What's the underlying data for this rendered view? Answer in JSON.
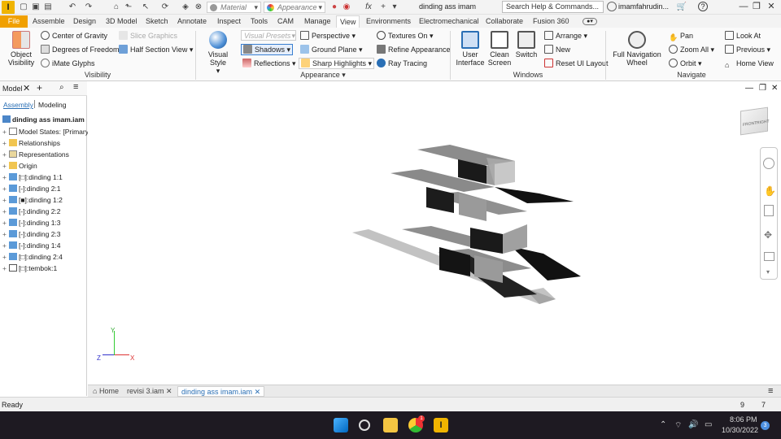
{
  "titlebar": {
    "app_logo": "I",
    "material_placeholder": "Material",
    "appearance_placeholder": "Appearance",
    "doc_title": "dinding ass imam",
    "search_placeholder": "Search Help & Commands...",
    "user": "imamfahrudin...",
    "help": "?",
    "fx": "fx"
  },
  "tabs": [
    "File",
    "Assemble",
    "Design",
    "3D Model",
    "Sketch",
    "Annotate",
    "Inspect",
    "Tools",
    "CAM",
    "Manage",
    "View",
    "Environments",
    "Electromechanical",
    "Collaborate",
    "Fusion 360"
  ],
  "ribbon": {
    "visibility": {
      "title": "Visibility",
      "object_visibility": "Object Visibility",
      "center_of_gravity": "Center of Gravity",
      "degrees_of_freedom": "Degrees of Freedom",
      "imate_glyphs": "iMate Glyphs",
      "slice_graphics": "Slice Graphics",
      "half_section_view": "Half Section View"
    },
    "appearance": {
      "title": "Appearance",
      "visual_style": "Visual Style",
      "visual_presets": "Visual Presets",
      "shadows": "Shadows",
      "reflections": "Reflections",
      "perspective": "Perspective",
      "ground_plane": "Ground Plane",
      "sharp_highlights": "Sharp Highlights",
      "textures_on": "Textures On",
      "refine_appearance": "Refine Appearance",
      "ray_tracing": "Ray Tracing"
    },
    "windows": {
      "title": "Windows",
      "user_interface": "User Interface",
      "clean_screen": "Clean Screen",
      "switch": "Switch",
      "arrange": "Arrange",
      "new": "New",
      "reset_ui_layout": "Reset UI Layout"
    },
    "navigate": {
      "title": "Navigate",
      "full_navigation_wheel": "Full Navigation Wheel",
      "pan": "Pan",
      "zoom_all": "Zoom All",
      "orbit": "Orbit",
      "look_at": "Look At",
      "previous": "Previous",
      "home_view": "Home View"
    }
  },
  "browser": {
    "header_label": "Model",
    "tab_assembly": "Assembly",
    "tab_modeling": "Modeling",
    "root": "dinding ass imam.iam",
    "items": [
      "Model States: [Primary]",
      "Relationships",
      "Representations",
      "Origin",
      "[□]:dinding 1:1",
      "[-]:dinding 2:1",
      "[■]:dinding 1:2",
      "[-]:dinding 2:2",
      "[-]:dinding 1:3",
      "[-]:dinding 2:3",
      "[-]:dinding 1:4",
      "[□]:dinding 2:4",
      "[□]:tembok:1"
    ]
  },
  "viewcube": {
    "front": "FRONT",
    "right": "RIGHT"
  },
  "doctabs": {
    "home": "Home",
    "tab1": "revisi 3.iam",
    "tab2": "dinding ass imam.iam"
  },
  "status": {
    "text": "Ready",
    "n1": "9",
    "n2": "7"
  },
  "taskbar": {
    "time": "8:06 PM",
    "date": "10/30/2022",
    "notifications": "3",
    "chrome_badge": "1"
  },
  "colors": {
    "accent": "#f0a000",
    "selection": "#2a6fb5"
  }
}
